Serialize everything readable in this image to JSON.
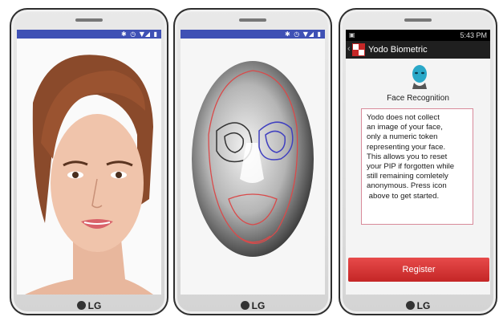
{
  "brand": "LG",
  "phones": [
    {
      "status_icons": "✱ ◷ ▼◢ ▮"
    },
    {
      "status_icons": "✱ ◷ ▼◢ ▮"
    },
    {
      "status_time": "5:43 PM",
      "app_title": "Yodo Biometric",
      "face_label": "Face Recognition",
      "info_lines": [
        "Yodo does not collect",
        "an image of your face,",
        "only a numeric token",
        "representing your face.",
        "This allows you to reset",
        "your PIP if forgotten while",
        "still remaining comletely",
        "anonymous. Press icon",
        " above to get started."
      ],
      "register_label": "Register"
    }
  ]
}
